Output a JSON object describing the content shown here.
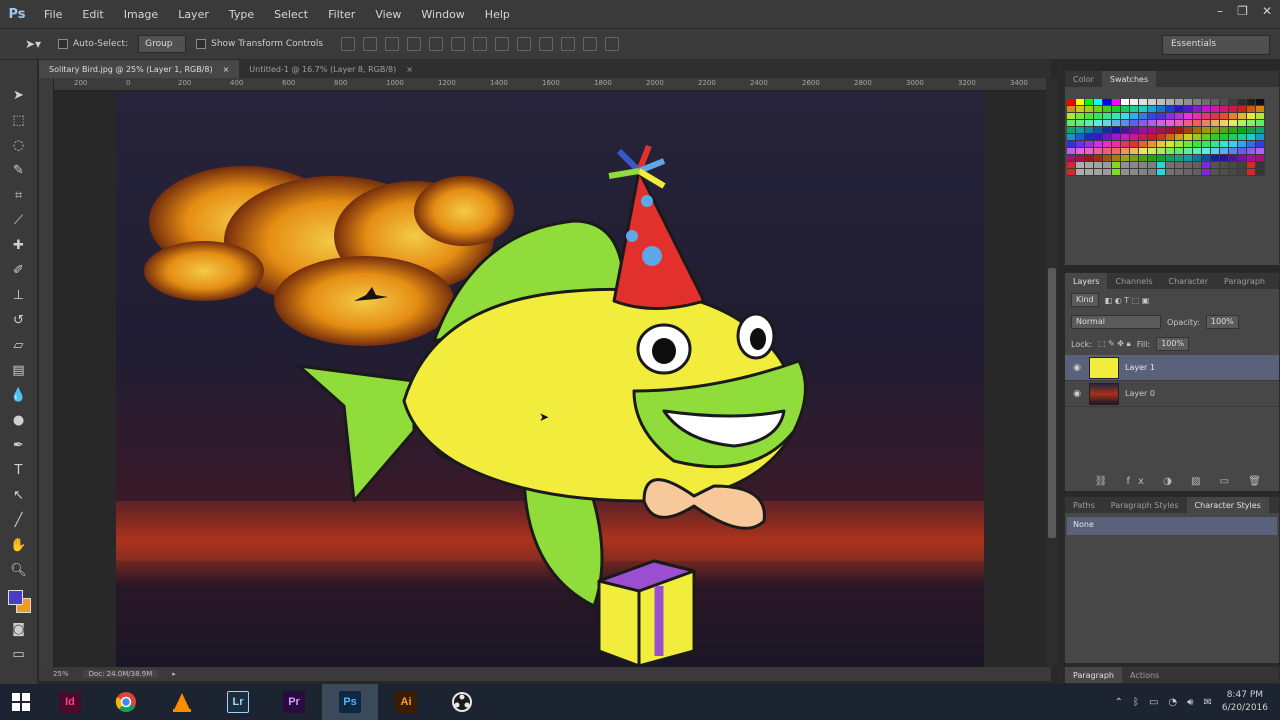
{
  "app": {
    "logo": "Ps",
    "menu": [
      "File",
      "Edit",
      "Image",
      "Layer",
      "Type",
      "Select",
      "Filter",
      "View",
      "Window",
      "Help"
    ]
  },
  "options_bar": {
    "auto_select_label": "Auto-Select:",
    "auto_select_value": "Group",
    "show_transform_label": "Show Transform Controls",
    "workspace": "Essentials"
  },
  "documents": {
    "tabs": [
      {
        "title": "Solitary Bird.jpg @ 25% (Layer 1, RGB/8)",
        "close": "×",
        "active": true
      },
      {
        "title": "Untitled-1 @ 16.7% (Layer 8, RGB/8)",
        "close": "×",
        "active": false
      }
    ]
  },
  "ruler": {
    "h_ticks": [
      "200",
      "0",
      "200",
      "400",
      "600",
      "800",
      "1000",
      "1200",
      "1400",
      "1600",
      "1800",
      "2000",
      "2200",
      "2400",
      "2600",
      "2800",
      "3000",
      "3200",
      "3400"
    ]
  },
  "status": {
    "zoom": "25%",
    "doc": "Doc: 24.0M/38.9M"
  },
  "panels": {
    "swatches_tabs": [
      "Color",
      "Swatches"
    ],
    "layers_tabs": [
      "Layers",
      "Channels",
      "Character",
      "Paragraph"
    ],
    "kind_label": "Kind",
    "blend_mode": "Normal",
    "opacity_label": "Opacity:",
    "opacity_value": "100%",
    "lock_label": "Lock:",
    "fill_label": "Fill:",
    "fill_value": "100%",
    "layers": [
      {
        "name": "Layer 1",
        "selected": true
      },
      {
        "name": "Layer 0",
        "selected": false
      }
    ],
    "styles_tabs": [
      "Paths",
      "Paragraph Styles",
      "Character Styles"
    ],
    "styles_item": "None",
    "bottom_tabs": [
      "Paragraph",
      "Actions"
    ]
  },
  "taskbar": {
    "apps": [
      {
        "name": "Id",
        "bg": "#4a0b2b",
        "fg": "#ff3c8e"
      },
      {
        "name": "chrome",
        "bg": "transparent",
        "fg": "#ffffff"
      },
      {
        "name": "vlc",
        "bg": "transparent",
        "fg": "#ff8c00"
      },
      {
        "name": "Lr",
        "bg": "#1b2e3e",
        "fg": "#9fd3ff"
      },
      {
        "name": "Pr",
        "bg": "#2a0b3f",
        "fg": "#d59bff"
      },
      {
        "name": "Ps",
        "bg": "#0f2740",
        "fg": "#4fb2ff"
      },
      {
        "name": "Ai",
        "bg": "#3b1d05",
        "fg": "#ff9a2a"
      },
      {
        "name": "obs",
        "bg": "transparent",
        "fg": "#ffffff"
      }
    ],
    "time": "8:47 PM",
    "date": "6/20/2016"
  }
}
